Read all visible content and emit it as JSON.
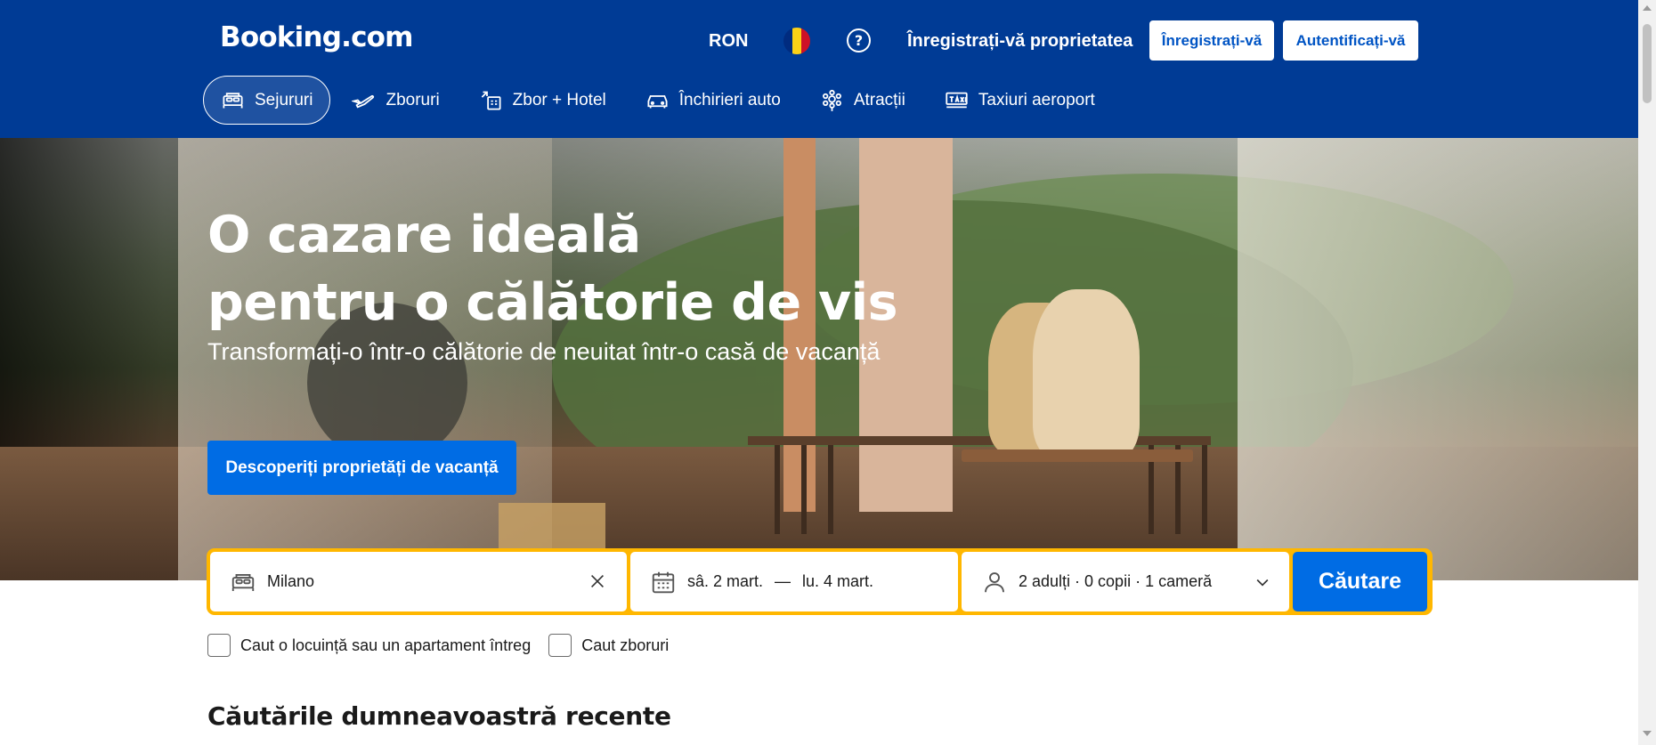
{
  "header": {
    "logo": "Booking.com",
    "currency": "RON",
    "language_flag_icon": "romania-flag-icon",
    "help_icon": "question-circle-icon",
    "list_property": "Înregistrați-vă proprietatea",
    "register_button": "Înregistrați-vă",
    "signin_button": "Autentificați-vă",
    "bg_color": "#003b95"
  },
  "nav": {
    "items": [
      {
        "label": "Sejururi",
        "icon": "bed-icon",
        "active": true
      },
      {
        "label": "Zboruri",
        "icon": "plane-icon",
        "active": false
      },
      {
        "label": "Zbor + Hotel",
        "icon": "flight-hotel-icon",
        "active": false
      },
      {
        "label": "Închirieri auto",
        "icon": "car-icon",
        "active": false
      },
      {
        "label": "Atracții",
        "icon": "attractions-icon",
        "active": false
      },
      {
        "label": "Taxiuri aeroport",
        "icon": "taxi-icon",
        "active": false
      }
    ]
  },
  "hero": {
    "title_line1": "O cazare ideală",
    "title_line2": "pentru o călătorie de vis",
    "subtitle": "Transformați-o într-o călătorie de neuitat într-o casă de vacanță",
    "cta_button": "Descoperiți proprietăți de vacanță",
    "cta_color": "#006ce4"
  },
  "search": {
    "destination": "Milano",
    "checkin": "sâ. 2 mart.",
    "date_separator": "—",
    "checkout": "lu. 4 mart.",
    "guests": "2 adulți · 0 copii · 1 cameră",
    "search_button": "Căutare",
    "border_color": "#ffb700"
  },
  "options": {
    "whole_home": "Caut o locuință sau un apartament întreg",
    "flights": "Caut zboruri"
  },
  "recent": {
    "title": "Căutările dumneavoastră recente"
  }
}
